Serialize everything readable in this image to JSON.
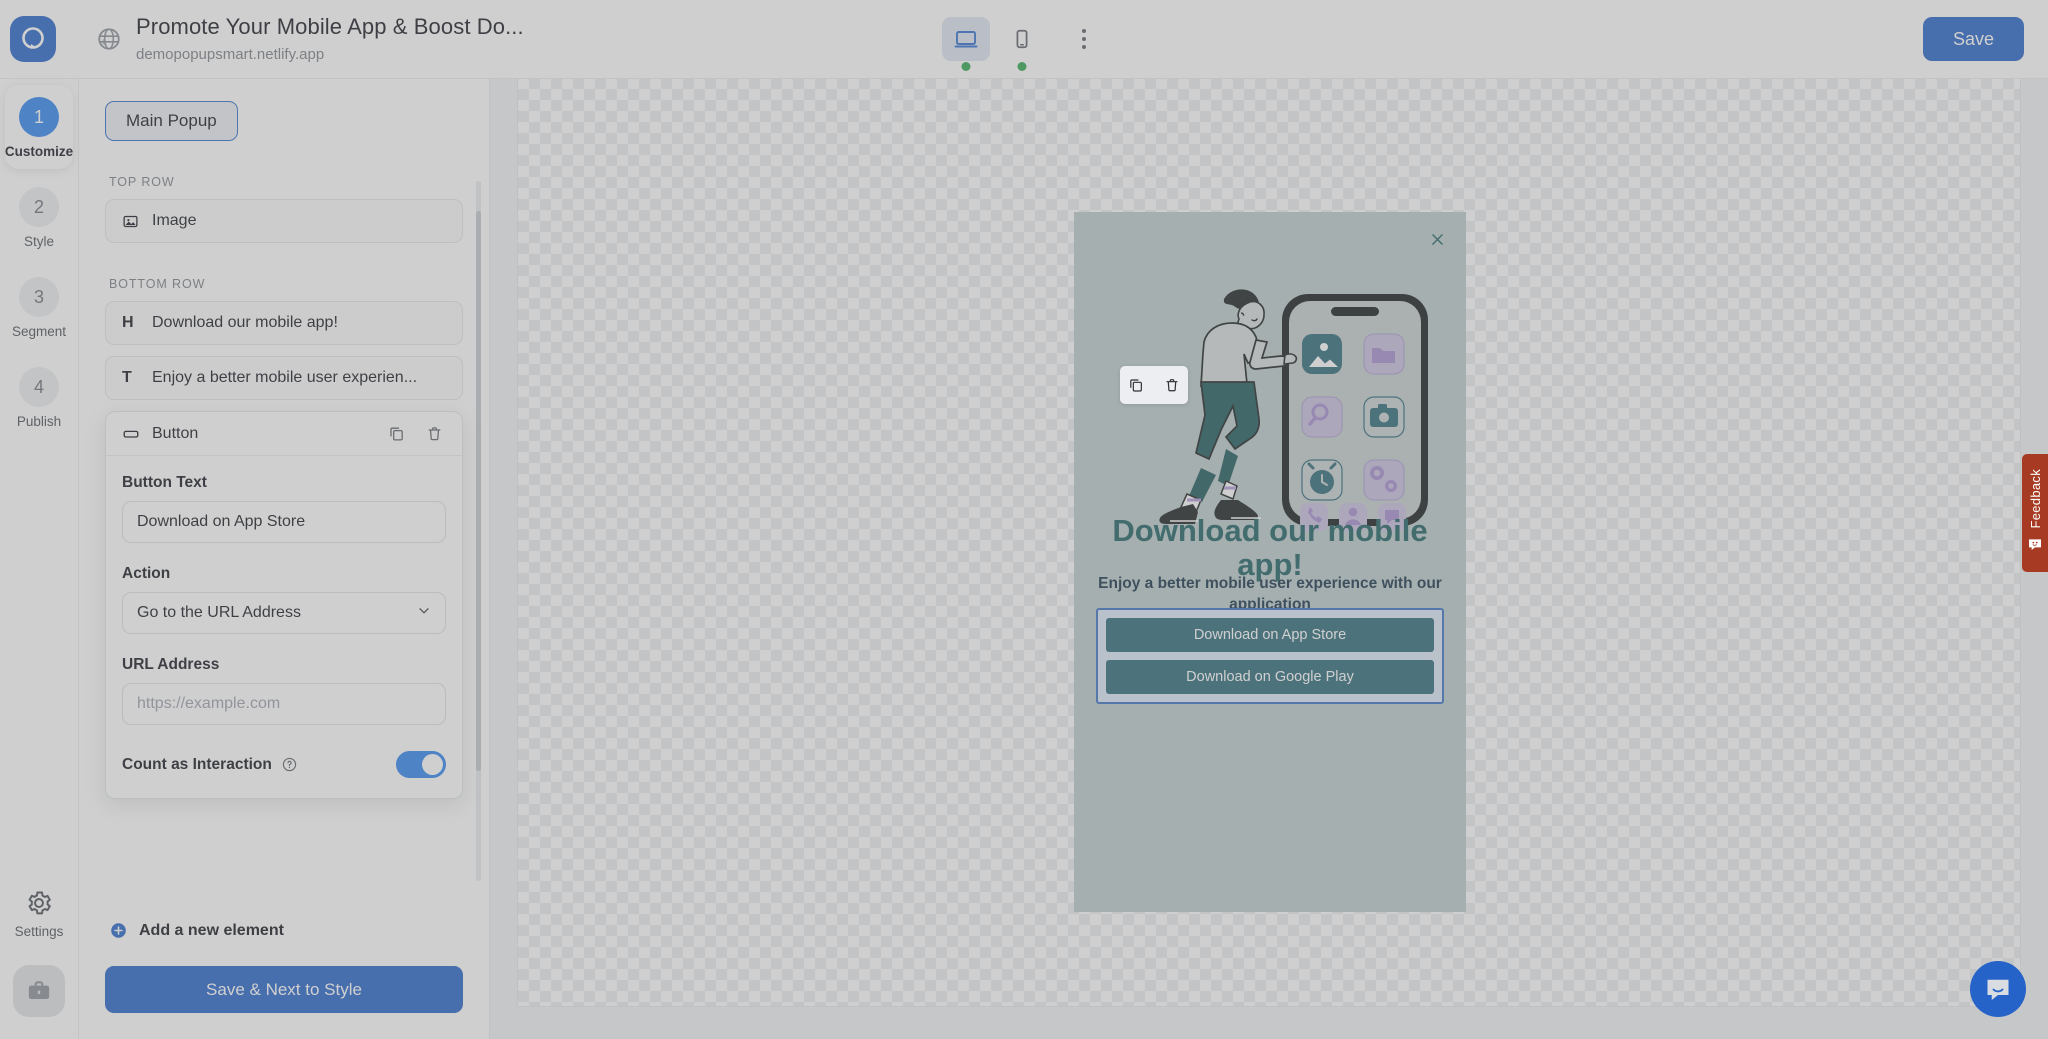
{
  "topbar": {
    "brand_icon": "popupsmart-logo-icon",
    "globe_icon": "globe-icon",
    "site_title": "Promote Your Mobile App & Boost Do...",
    "site_url": "demopopupsmart.netlify.app",
    "devices": [
      {
        "name": "desktop",
        "icon": "desktop-icon",
        "active": true,
        "status_dot": "#2fa84f"
      },
      {
        "name": "mobile",
        "icon": "mobile-icon",
        "active": false,
        "status_dot": "#2fa84f"
      }
    ],
    "more_icon": "kebab-menu-icon",
    "save_label": "Save"
  },
  "rail": {
    "steps": [
      {
        "num": "1",
        "label": "Customize",
        "active": true
      },
      {
        "num": "2",
        "label": "Style",
        "active": false
      },
      {
        "num": "3",
        "label": "Segment",
        "active": false
      },
      {
        "num": "4",
        "label": "Publish",
        "active": false
      }
    ],
    "settings_label": "Settings",
    "settings_icon": "gear-icon",
    "workspace_icon": "briefcase-icon"
  },
  "panel": {
    "popup_chip": "Main Popup",
    "sections": [
      {
        "label": "TOP ROW",
        "items": [
          {
            "icon": "image-icon",
            "glyph": "image",
            "text": "Image"
          }
        ]
      },
      {
        "label": "BOTTOM ROW",
        "items": [
          {
            "icon": "heading-icon",
            "glyph": "H",
            "text": "Download our mobile app!"
          },
          {
            "icon": "text-icon",
            "glyph": "T",
            "text": "Enjoy a better mobile user experien..."
          }
        ]
      }
    ],
    "button_card": {
      "title": "Button",
      "title_icon": "button-icon",
      "copy_icon": "copy-icon",
      "delete_icon": "trash-icon",
      "button_text_label": "Button Text",
      "button_text_value": "Download on App Store",
      "action_label": "Action",
      "action_value": "Go to the URL Address",
      "action_chevron": "chevron-down-icon",
      "url_label": "URL Address",
      "url_value": "",
      "url_placeholder": "https://example.com",
      "count_label": "Count as Interaction",
      "help_icon": "question-mark-icon",
      "count_enabled": true
    },
    "add_element_label": "Add a new element",
    "add_element_icon": "plus-circle-icon",
    "next_label": "Save & Next to Style"
  },
  "popup": {
    "close_icon": "close-icon",
    "background_color": "#bccccb",
    "heading": "Download our mobile app!",
    "subtext": "Enjoy a better mobile user experience with our application",
    "buttons": [
      {
        "label": "Download on App Store"
      },
      {
        "label": "Download on Google Play"
      }
    ],
    "selection_color": "#3a72c7",
    "cta_color": "#2d6a79",
    "heading_color": "#1c5f61",
    "float_toolbar": {
      "copy_icon": "copy-icon",
      "delete_icon": "trash-icon"
    },
    "illustration": {
      "name": "man-tapping-phone-illustration",
      "app_icons": [
        "photo-icon",
        "folder-icon",
        "search-icon",
        "camera-icon",
        "alarm-clock-icon",
        "gears-icon",
        "phone-icon",
        "contact-icon",
        "message-icon"
      ]
    }
  },
  "feedback": {
    "label": "Feedback",
    "icon": "feedback-smiley-icon",
    "color": "#a63a22"
  },
  "intercom": {
    "icon": "chat-bubble-icon",
    "color": "#2563c9"
  }
}
